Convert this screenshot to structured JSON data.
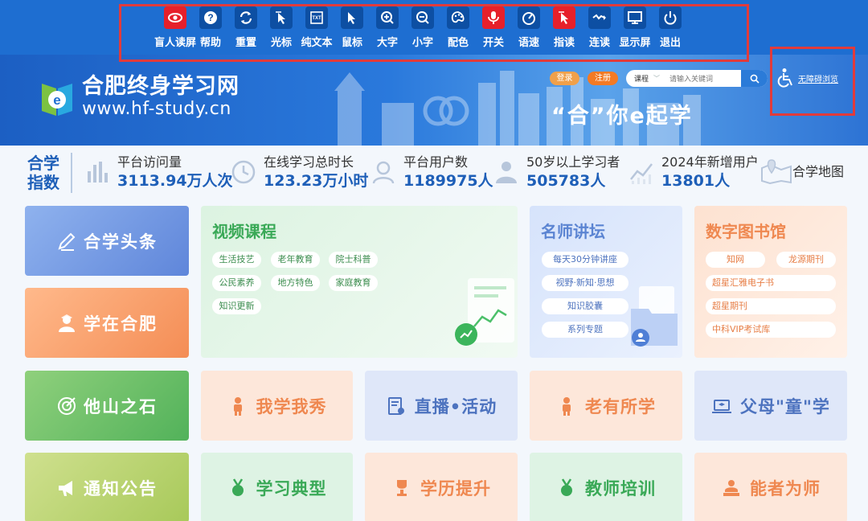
{
  "toolbar": {
    "items": [
      {
        "label": "盲人读屏",
        "icon": "eye-icon",
        "red": true
      },
      {
        "label": "帮助",
        "icon": "help-icon",
        "red": false
      },
      {
        "label": "重置",
        "icon": "reset-icon",
        "red": false
      },
      {
        "label": "光标",
        "icon": "cursor-icon",
        "red": false
      },
      {
        "label": "纯文本",
        "icon": "text-only-icon",
        "red": false
      },
      {
        "label": "鼠标",
        "icon": "mouse-pointer-icon",
        "red": false
      },
      {
        "label": "大字",
        "icon": "zoom-in-icon",
        "red": false
      },
      {
        "label": "小字",
        "icon": "zoom-out-icon",
        "red": false
      },
      {
        "label": "配色",
        "icon": "palette-icon",
        "red": false
      },
      {
        "label": "开关",
        "icon": "microphone-icon",
        "red": true
      },
      {
        "label": "语速",
        "icon": "speedometer-icon",
        "red": false
      },
      {
        "label": "指读",
        "icon": "pointer-read-icon",
        "red": true
      },
      {
        "label": "连读",
        "icon": "continuous-read-icon",
        "red": false
      },
      {
        "label": "显示屏",
        "icon": "monitor-icon",
        "red": false
      },
      {
        "label": "退出",
        "icon": "power-icon",
        "red": false
      }
    ]
  },
  "header": {
    "site_name": "合肥终身学习网",
    "site_url": "www.hf-study.cn",
    "slogan": "“合”你e起学",
    "login_label": "登录",
    "register_label": "注册",
    "search_category": "课程",
    "search_placeholder": "请输入关键词",
    "accessible_label": "无障碍浏览"
  },
  "stats": {
    "title_line1": "合学",
    "title_line2": "指数",
    "items": [
      {
        "label": "平台访问量",
        "value": "3113.94万人次"
      },
      {
        "label": "在线学习总时长",
        "value": "123.23万小时"
      },
      {
        "label": "平台用户数",
        "value": "1189975人"
      },
      {
        "label": "50岁以上学习者",
        "value": "505783人"
      },
      {
        "label": "2024年新增用户",
        "value": "13801人"
      }
    ],
    "map_label": "合学地图"
  },
  "blocks": {
    "headline": "合学头条",
    "study_in_hefei": "学在合肥",
    "other_stones": "他山之石",
    "notices": "通知公告"
  },
  "video": {
    "title": "视频课程",
    "tags": [
      "生活技艺",
      "老年教育",
      "院士科普",
      "公民素养",
      "地方特色",
      "家庭教育",
      "知识更新"
    ]
  },
  "lectures": {
    "title": "名师讲坛",
    "tags": [
      "每天30分钟讲座",
      "视野·新知·思想",
      "知识胶囊",
      "系列专题"
    ]
  },
  "library": {
    "title": "数字图书馆",
    "tags": [
      "知网",
      "龙源期刊",
      "超星汇雅电子书",
      "超星期刊",
      "中科VIP考试库"
    ]
  },
  "tiles_row1": [
    "我学我秀",
    "直播•活动",
    "老有所学",
    "父母\"童\"学"
  ],
  "tiles_row2": [
    "学习典型",
    "学历提升",
    "教师培训",
    "能者为师"
  ]
}
